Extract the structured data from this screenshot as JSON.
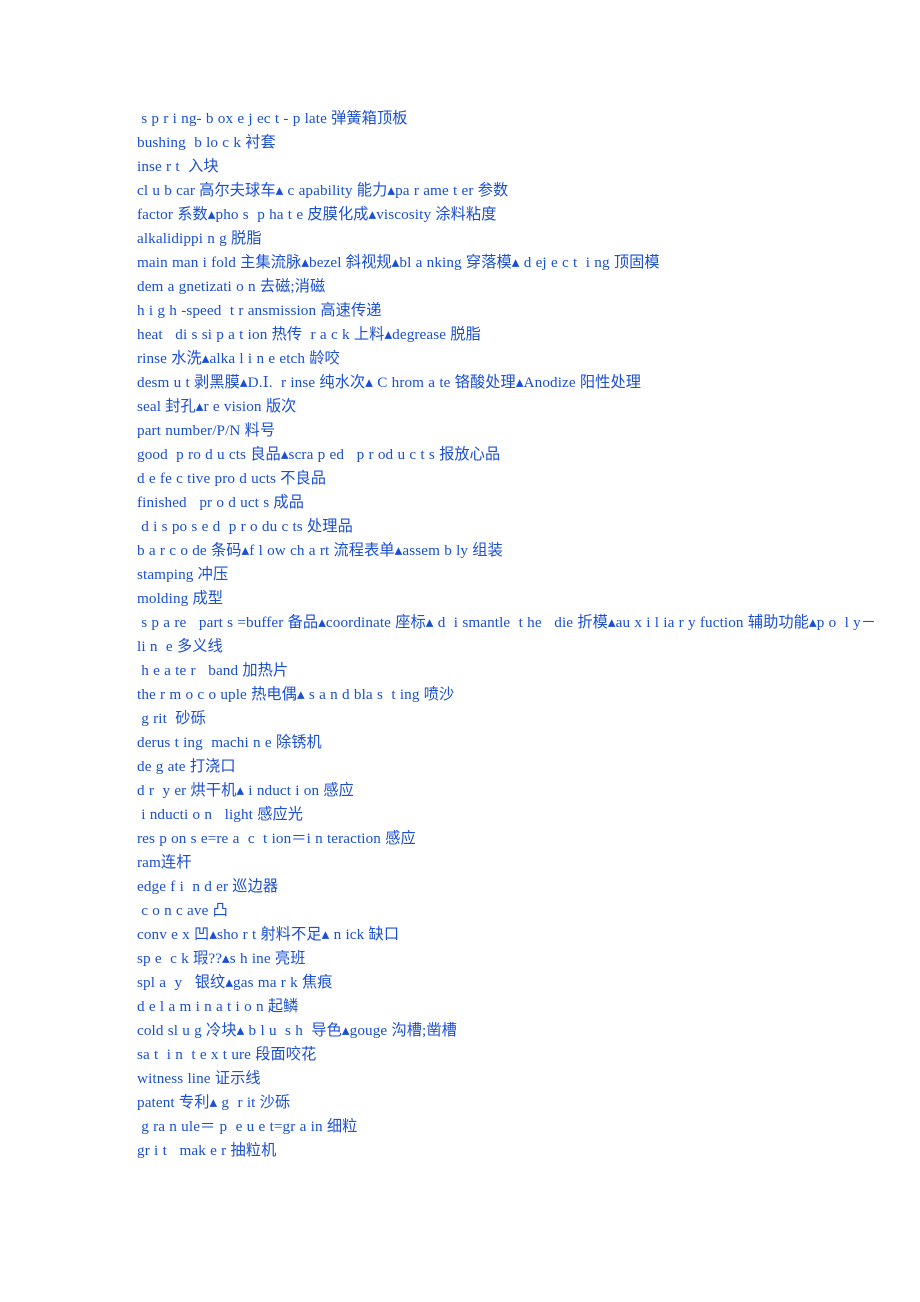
{
  "document": {
    "type": "glossary-word-list",
    "text_color": "#1b4fd4",
    "background_color": "#ffffff",
    "language": "English-Chinese bilingual technical glossary",
    "separator_glyph": "▴",
    "lines": [
      " s p r i ng- b ox e j ec t - p late 弹簧箱顶板",
      "bushing  b lo c k 衬套",
      "inse r t  入块",
      "cl u b car 高尔夫球车▴ c apability 能力▴pa r ame t er 参数",
      "factor 系数▴pho s  p ha t e 皮膜化成▴viscosity 涂料粘度",
      "alkalidippi n g 脱脂",
      "main man i fold 主集流脉▴bezel 斜视规▴bl a nking 穿落模▴ d ej e c t  i ng 顶固模",
      "dem a gnetizati o n 去磁;消磁",
      "h i g h -speed  t r ansmission 高速传递",
      "heat   di s si p a t ion 热传  r a c k 上料▴degrease 脱脂",
      "rinse 水洗▴alka l i n e etch 龄咬",
      "desm u t 剥黑膜▴D.Ⅰ.  r inse 纯水次▴ C hrom a te 铬酸处理▴Anodize 阳性处理",
      "seal 封孔▴r e vision 版次",
      "part number/P/N 料号",
      "good  p ro d u cts 良品▴scra p ed   p r od u c t s 报放心品",
      "d e fe c tive pro d ucts 不良品",
      "finished   pr o d uct s 成品",
      " d i s po s e d  p r o du c ts 处理品",
      "b a r c o de 条码▴f l ow ch a rt 流程表单▴assem b ly 组装",
      "stamping 冲压",
      "molding 成型",
      " s p a re   part s =buffer 备品▴coordinate 座标▴ d  i smantle  t he   die 折模▴au x i l ia r y fuction 辅助功能▴p o  l y－li n  e 多义线",
      " h e a te r   band 加热片",
      "the r m o c o uple 热电偶▴ s a n d bla s  t ing 喷沙",
      " g rit  砂砾",
      "derus t ing  machi n e 除锈机",
      "de g ate 打浇口",
      "d r  y er 烘干机▴ i nduct i on 感应",
      " i nducti o n   light 感应光",
      "res p on s e=re a  c  t ion＝i n teraction 感应",
      "ram连杆",
      "edge f i  n d er 巡边器",
      " c o n c ave 凸",
      "conv e x 凹▴sho r t 射料不足▴ n ick 缺口",
      "sp e  c k 瑕??▴s h ine 亮班",
      "spl a  y   银纹▴gas ma r k 焦痕",
      "d e l a m i n a t i o n 起鳞",
      "cold sl u g 冷块▴ b l u  s h  导色▴gouge 沟槽;凿槽",
      "sa t  i n  t e x t ure 段面咬花",
      "witness line 证示线",
      "patent 专利▴ g  r it 沙砾",
      " g ra n ule＝ p  e u e t=gr a in 细粒",
      "gr i t   mak e r 抽粒机"
    ]
  }
}
